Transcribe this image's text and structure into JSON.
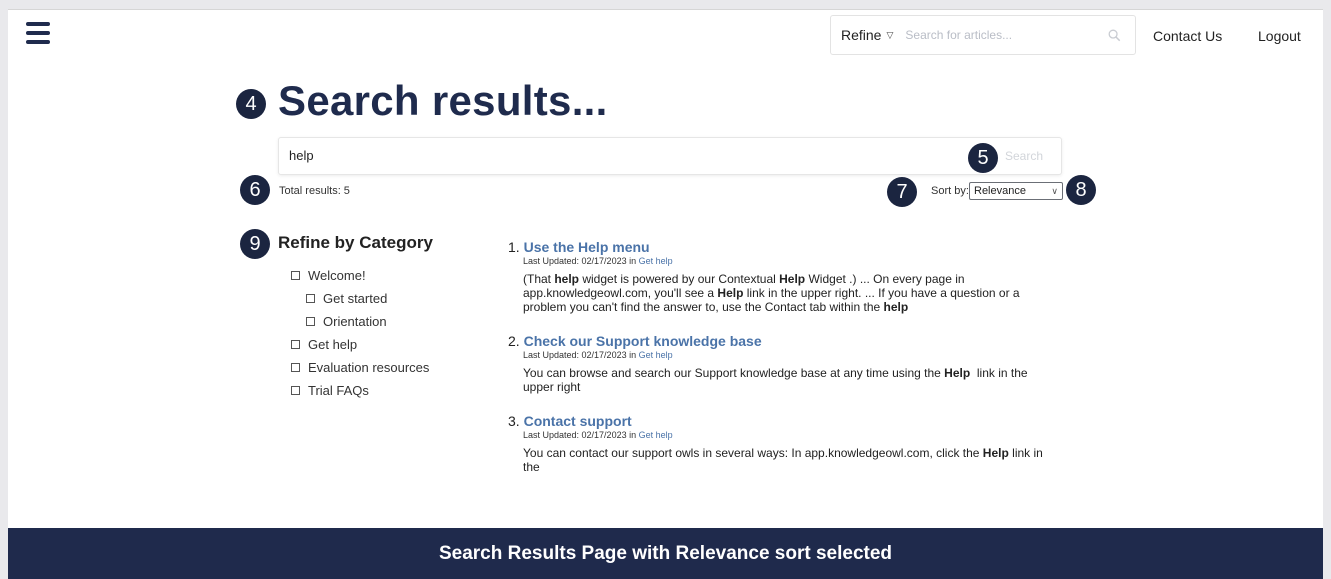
{
  "header": {
    "refine_label": "Refine",
    "search_placeholder": "Search for articles...",
    "contact_label": "Contact Us",
    "logout_label": "Logout"
  },
  "badges": {
    "b4": "4",
    "b5": "5",
    "b6": "6",
    "b7": "7",
    "b8": "8",
    "b9": "9"
  },
  "main": {
    "title": "Search results...",
    "search_value": "help",
    "search_button": "Search",
    "total_results": "Total results: 5",
    "sort_label": "Sort by:",
    "sort_selected": "Relevance"
  },
  "sidebar": {
    "heading": "Refine by Category",
    "categories": [
      {
        "label": "Welcome!",
        "level": 0
      },
      {
        "label": "Get started",
        "level": 1
      },
      {
        "label": "Orientation",
        "level": 1
      },
      {
        "label": "Get help",
        "level": 0
      },
      {
        "label": "Evaluation resources",
        "level": 0
      },
      {
        "label": "Trial FAQs",
        "level": 0
      }
    ]
  },
  "results": [
    {
      "num": "1.",
      "title": "Use the Help menu",
      "meta_prefix": "Last Updated: 02/17/2023 in",
      "category": "Get help",
      "snippet_html": "(That <b>help</b> widget is powered by our Contextual <b>Help</b> Widget .) ... On every page in app.knowledgeowl.com, you'll see a <b>Help</b> link in the upper right. ... If you have a question or a problem you can't find the answer to, use the Contact tab within the <b>help</b>"
    },
    {
      "num": "2.",
      "title": "Check our Support knowledge base",
      "meta_prefix": "Last Updated: 02/17/2023 in",
      "category": "Get help",
      "snippet_html": "You can browse and search our Support knowledge base at any time using the <b>Help</b>&nbsp; link in the upper right"
    },
    {
      "num": "3.",
      "title": "Contact support",
      "meta_prefix": "Last Updated: 02/17/2023 in",
      "category": "Get help",
      "snippet_html": "You can contact our support owls in several ways: In app.knowledgeowl.com, click the <b>Help</b> link in the"
    }
  ],
  "caption": "Search Results Page with Relevance sort selected",
  "colors": {
    "navy": "#1f2b4d",
    "link": "#4a73a8"
  }
}
